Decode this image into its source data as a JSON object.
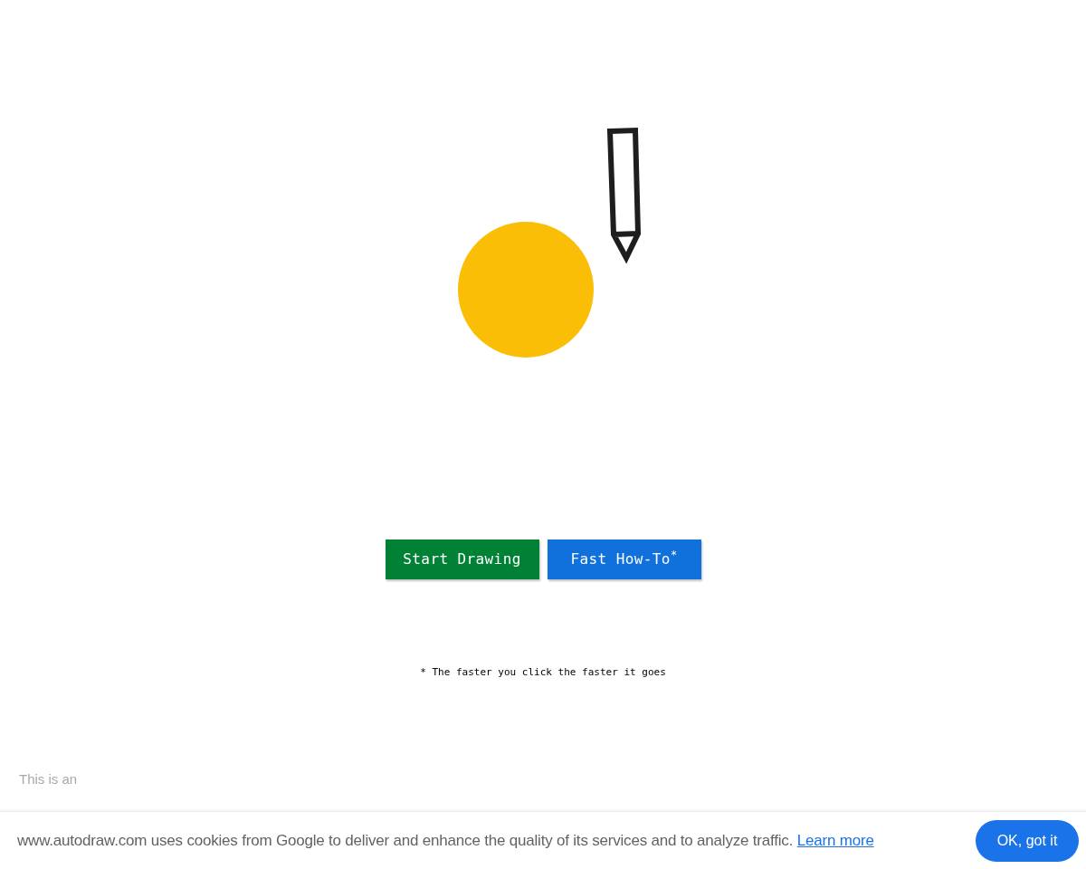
{
  "buttons": [
    {
      "label": "Start Drawing",
      "kind": "primary"
    },
    {
      "label": "Fast How-To$^{*}$",
      "kind": "secondary"
    }
  ],
  "footnote": "* The faster you click the faster it goes",
  "tagline": {
    "intro": "This is an"
  },
  "cookie_banner": {
    "message": "www.autodraw.com uses cookies from Google to deliver and enhance the quality of its services and to analyze traffic.",
    "link": "Learn more",
    "button": "OK, got it"
  }
}
